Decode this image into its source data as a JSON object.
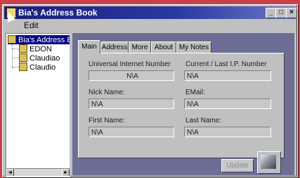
{
  "window": {
    "title": "Bia's Address Book"
  },
  "titlebar_buttons": [
    "_",
    "□",
    "×"
  ],
  "menu": {
    "edit": "Edit"
  },
  "tree": {
    "root": "Bia's Address Bo",
    "items": [
      "EDON",
      "Claudiao",
      "Claudio"
    ]
  },
  "tabs": [
    "Main",
    "Address",
    "More",
    "About",
    "My Notes"
  ],
  "form": {
    "uin_label": "Universal Internet Number",
    "uin_value": "N\\A",
    "ip_label": "Current / Last I.P. Number",
    "ip_value": "N\\A",
    "nick_label": "Nick Name:",
    "nick_value": "N\\A",
    "email_label": "EMail:",
    "email_value": "N\\A",
    "first_label": "First Name:",
    "first_value": "N\\A",
    "last_label": "Last Name:",
    "last_value": "N\\A"
  },
  "buttons": {
    "update": "Update"
  },
  "scroll_arrows": {
    "left": "◄",
    "right": "►"
  }
}
